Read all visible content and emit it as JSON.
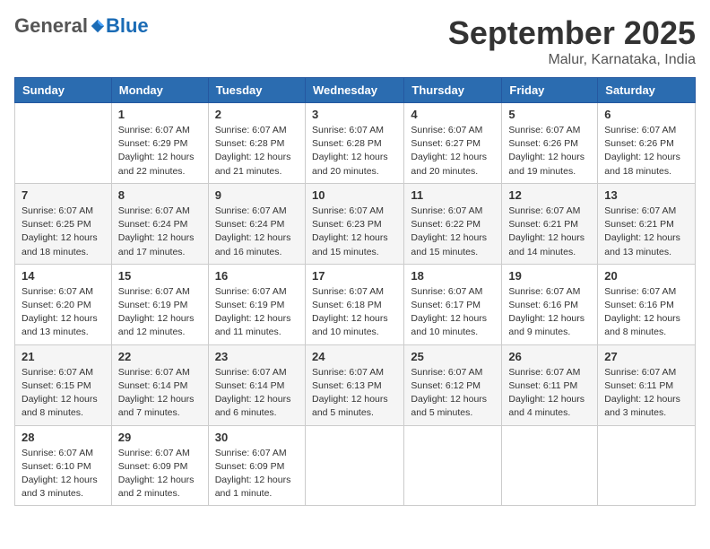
{
  "logo": {
    "general": "General",
    "blue": "Blue"
  },
  "title": "September 2025",
  "location": "Malur, Karnataka, India",
  "days_of_week": [
    "Sunday",
    "Monday",
    "Tuesday",
    "Wednesday",
    "Thursday",
    "Friday",
    "Saturday"
  ],
  "weeks": [
    [
      {
        "day": "",
        "info": ""
      },
      {
        "day": "1",
        "info": "Sunrise: 6:07 AM\nSunset: 6:29 PM\nDaylight: 12 hours\nand 22 minutes."
      },
      {
        "day": "2",
        "info": "Sunrise: 6:07 AM\nSunset: 6:28 PM\nDaylight: 12 hours\nand 21 minutes."
      },
      {
        "day": "3",
        "info": "Sunrise: 6:07 AM\nSunset: 6:28 PM\nDaylight: 12 hours\nand 20 minutes."
      },
      {
        "day": "4",
        "info": "Sunrise: 6:07 AM\nSunset: 6:27 PM\nDaylight: 12 hours\nand 20 minutes."
      },
      {
        "day": "5",
        "info": "Sunrise: 6:07 AM\nSunset: 6:26 PM\nDaylight: 12 hours\nand 19 minutes."
      },
      {
        "day": "6",
        "info": "Sunrise: 6:07 AM\nSunset: 6:26 PM\nDaylight: 12 hours\nand 18 minutes."
      }
    ],
    [
      {
        "day": "7",
        "info": "Sunrise: 6:07 AM\nSunset: 6:25 PM\nDaylight: 12 hours\nand 18 minutes."
      },
      {
        "day": "8",
        "info": "Sunrise: 6:07 AM\nSunset: 6:24 PM\nDaylight: 12 hours\nand 17 minutes."
      },
      {
        "day": "9",
        "info": "Sunrise: 6:07 AM\nSunset: 6:24 PM\nDaylight: 12 hours\nand 16 minutes."
      },
      {
        "day": "10",
        "info": "Sunrise: 6:07 AM\nSunset: 6:23 PM\nDaylight: 12 hours\nand 15 minutes."
      },
      {
        "day": "11",
        "info": "Sunrise: 6:07 AM\nSunset: 6:22 PM\nDaylight: 12 hours\nand 15 minutes."
      },
      {
        "day": "12",
        "info": "Sunrise: 6:07 AM\nSunset: 6:21 PM\nDaylight: 12 hours\nand 14 minutes."
      },
      {
        "day": "13",
        "info": "Sunrise: 6:07 AM\nSunset: 6:21 PM\nDaylight: 12 hours\nand 13 minutes."
      }
    ],
    [
      {
        "day": "14",
        "info": "Sunrise: 6:07 AM\nSunset: 6:20 PM\nDaylight: 12 hours\nand 13 minutes."
      },
      {
        "day": "15",
        "info": "Sunrise: 6:07 AM\nSunset: 6:19 PM\nDaylight: 12 hours\nand 12 minutes."
      },
      {
        "day": "16",
        "info": "Sunrise: 6:07 AM\nSunset: 6:19 PM\nDaylight: 12 hours\nand 11 minutes."
      },
      {
        "day": "17",
        "info": "Sunrise: 6:07 AM\nSunset: 6:18 PM\nDaylight: 12 hours\nand 10 minutes."
      },
      {
        "day": "18",
        "info": "Sunrise: 6:07 AM\nSunset: 6:17 PM\nDaylight: 12 hours\nand 10 minutes."
      },
      {
        "day": "19",
        "info": "Sunrise: 6:07 AM\nSunset: 6:16 PM\nDaylight: 12 hours\nand 9 minutes."
      },
      {
        "day": "20",
        "info": "Sunrise: 6:07 AM\nSunset: 6:16 PM\nDaylight: 12 hours\nand 8 minutes."
      }
    ],
    [
      {
        "day": "21",
        "info": "Sunrise: 6:07 AM\nSunset: 6:15 PM\nDaylight: 12 hours\nand 8 minutes."
      },
      {
        "day": "22",
        "info": "Sunrise: 6:07 AM\nSunset: 6:14 PM\nDaylight: 12 hours\nand 7 minutes."
      },
      {
        "day": "23",
        "info": "Sunrise: 6:07 AM\nSunset: 6:14 PM\nDaylight: 12 hours\nand 6 minutes."
      },
      {
        "day": "24",
        "info": "Sunrise: 6:07 AM\nSunset: 6:13 PM\nDaylight: 12 hours\nand 5 minutes."
      },
      {
        "day": "25",
        "info": "Sunrise: 6:07 AM\nSunset: 6:12 PM\nDaylight: 12 hours\nand 5 minutes."
      },
      {
        "day": "26",
        "info": "Sunrise: 6:07 AM\nSunset: 6:11 PM\nDaylight: 12 hours\nand 4 minutes."
      },
      {
        "day": "27",
        "info": "Sunrise: 6:07 AM\nSunset: 6:11 PM\nDaylight: 12 hours\nand 3 minutes."
      }
    ],
    [
      {
        "day": "28",
        "info": "Sunrise: 6:07 AM\nSunset: 6:10 PM\nDaylight: 12 hours\nand 3 minutes."
      },
      {
        "day": "29",
        "info": "Sunrise: 6:07 AM\nSunset: 6:09 PM\nDaylight: 12 hours\nand 2 minutes."
      },
      {
        "day": "30",
        "info": "Sunrise: 6:07 AM\nSunset: 6:09 PM\nDaylight: 12 hours\nand 1 minute."
      },
      {
        "day": "",
        "info": ""
      },
      {
        "day": "",
        "info": ""
      },
      {
        "day": "",
        "info": ""
      },
      {
        "day": "",
        "info": ""
      }
    ]
  ]
}
